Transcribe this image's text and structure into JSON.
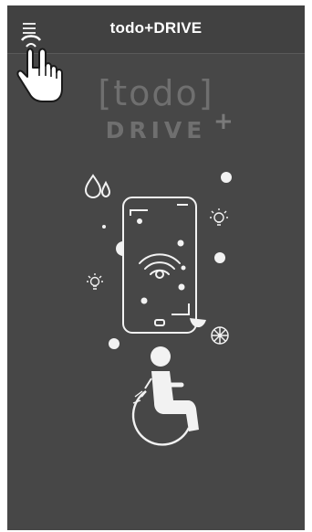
{
  "appbar": {
    "title": "todo+DRIVE",
    "menu_icon": "hamburger-menu-icon",
    "cursor_icon": "pointing-hand-cursor-icon"
  },
  "logo": {
    "line1": "[todo]",
    "line2": "DRIVE",
    "plus": "+"
  },
  "illustration": {
    "icons": [
      "water-drops-icon",
      "lightbulb-icon",
      "smartphone-icon",
      "wifi-icon",
      "wheel-icon",
      "wheelchair-user-icon"
    ]
  },
  "colors": {
    "background": "#474747",
    "appbar": "#414141",
    "title": "#ffffff",
    "logo": "#6f6f6f",
    "illustration": "#f2f2f2"
  }
}
